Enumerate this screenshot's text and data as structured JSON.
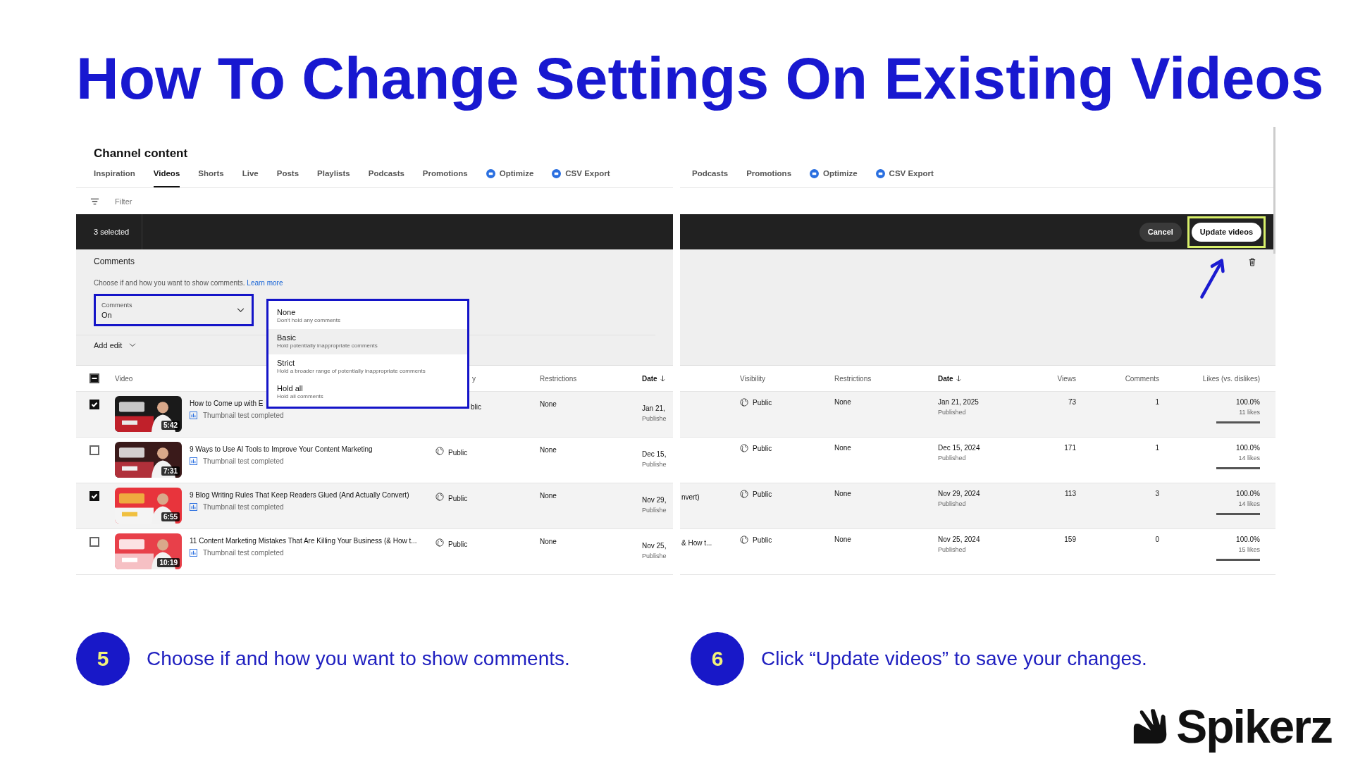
{
  "title": "How To Change Settings On Existing Videos",
  "left_panel": {
    "heading": "Channel content",
    "tabs": [
      {
        "label": "Inspiration",
        "selected": false,
        "icon": false
      },
      {
        "label": "Videos",
        "selected": true,
        "icon": false
      },
      {
        "label": "Shorts",
        "selected": false,
        "icon": false
      },
      {
        "label": "Live",
        "selected": false,
        "icon": false
      },
      {
        "label": "Posts",
        "selected": false,
        "icon": false
      },
      {
        "label": "Playlists",
        "selected": false,
        "icon": false
      },
      {
        "label": "Podcasts",
        "selected": false,
        "icon": false
      },
      {
        "label": "Promotions",
        "selected": false,
        "icon": false
      },
      {
        "label": "Optimize",
        "selected": false,
        "icon": true
      },
      {
        "label": "CSV Export",
        "selected": false,
        "icon": true
      }
    ],
    "filter": {
      "placeholder": "Filter"
    },
    "selection_count": "3 selected",
    "edit_section": {
      "label": "Comments",
      "description": "Choose if and how you want to show comments.",
      "link": "Learn more",
      "field": {
        "label": "Comments",
        "value": "On",
        "highlighted": true
      }
    },
    "menu": {
      "highlighted": true,
      "options": [
        {
          "label": "None",
          "hint": "Don't hold any comments",
          "hovered": false
        },
        {
          "label": "Basic",
          "hint": "Hold potentially inappropriate comments",
          "hovered": true
        },
        {
          "label": "Strict",
          "hint": "Hold a broader range of potentially inappropriate comments",
          "hovered": false
        },
        {
          "label": "Hold all",
          "hint": "Hold all comments",
          "hovered": false
        }
      ]
    },
    "add_edit": "Add edit",
    "select_all": {
      "indeterminate": true
    },
    "columns": [
      "Video",
      "y",
      "Restrictions",
      "Date"
    ],
    "rows": [
      {
        "checked": true,
        "duration": "5:42",
        "title": "How to Come up with E",
        "status": "Thumbnail test completed",
        "visibility": {
          "text": "blic",
          "icon": false
        },
        "restrictions": "None",
        "date": "Jan 21,",
        "date_status": "Publishe"
      },
      {
        "checked": false,
        "duration": "7:31",
        "title": "9 Ways to Use AI Tools to Improve Your Content Marketing",
        "status": "Thumbnail test completed",
        "visibility": {
          "text": "Public",
          "icon": true
        },
        "restrictions": "None",
        "date": "Dec 15,",
        "date_status": "Publishe"
      },
      {
        "checked": true,
        "duration": "6:55",
        "title": "9 Blog Writing Rules That Keep Readers Glued (And Actually Convert)",
        "status": "Thumbnail test completed",
        "visibility": {
          "text": "Public",
          "icon": true
        },
        "restrictions": "None",
        "date": "Nov 29,",
        "date_status": "Publishe"
      },
      {
        "checked": false,
        "duration": "10:19",
        "title": "11 Content Marketing Mistakes That Are Killing Your Business (& How t...",
        "status": "Thumbnail test completed",
        "visibility": {
          "text": "Public",
          "icon": true
        },
        "restrictions": "None",
        "date": "Nov 25,",
        "date_status": "Publishe"
      }
    ]
  },
  "right_panel": {
    "tabs": [
      {
        "label": "Podcasts",
        "icon": false
      },
      {
        "label": "Promotions",
        "icon": false
      },
      {
        "label": "Optimize",
        "icon": true
      },
      {
        "label": "CSV Export",
        "icon": true
      }
    ],
    "buttons": [
      {
        "label": "Cancel",
        "kind": "secondary",
        "highlighted": false
      },
      {
        "label": "Update videos",
        "kind": "primary",
        "highlighted": true
      }
    ],
    "columns": [
      {
        "label": "Visibility",
        "sorted": false
      },
      {
        "label": "Restrictions",
        "sorted": false
      },
      {
        "label": "Date",
        "sorted": true
      },
      {
        "label": "Views",
        "sorted": false
      },
      {
        "label": "Comments",
        "sorted": false
      },
      {
        "label": "Likes (vs. dislikes)",
        "sorted": false
      }
    ],
    "rows": [
      {
        "checked": true,
        "visibility": "Public",
        "restrictions": "None",
        "date": "Jan 21, 2025",
        "date_status": "Published",
        "views": "73",
        "comments": "1",
        "likes_percent": "100.0%",
        "likes": "11 likes",
        "level": 1
      },
      {
        "checked": false,
        "visibility": "Public",
        "restrictions": "None",
        "date": "Dec 15, 2024",
        "date_status": "Published",
        "views": "171",
        "comments": "1",
        "likes_percent": "100.0%",
        "likes": "14 likes",
        "level": 1
      },
      {
        "checked": true,
        "title_end": "nvert)",
        "visibility": "Public",
        "restrictions": "None",
        "date": "Nov 29, 2024",
        "date_status": "Published",
        "views": "113",
        "comments": "3",
        "likes_percent": "100.0%",
        "likes": "14 likes",
        "level": 1
      },
      {
        "checked": false,
        "title_end": "& How t...",
        "visibility": "Public",
        "restrictions": "None",
        "date": "Nov 25, 2024",
        "date_status": "Published",
        "views": "159",
        "comments": "0",
        "likes_percent": "100.0%",
        "likes": "15 likes",
        "level": 1
      }
    ]
  },
  "steps": [
    {
      "number": "5",
      "text": "Choose if and how you want to show comments."
    },
    {
      "number": "6",
      "text": "Click “Update videos” to save your changes."
    }
  ],
  "logo": "Spikerz"
}
